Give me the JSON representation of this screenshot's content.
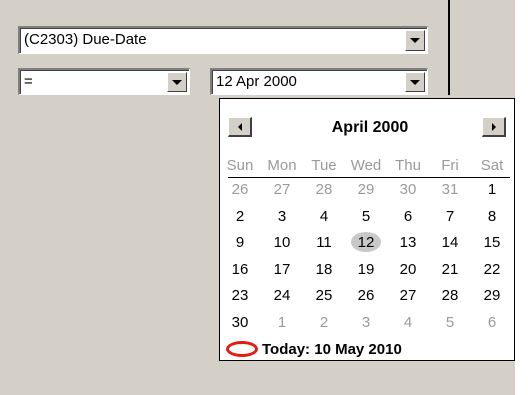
{
  "field_combo": {
    "value": "(C2303)  Due-Date"
  },
  "operator_combo": {
    "value": "="
  },
  "date_combo": {
    "value": "12 Apr 2000"
  },
  "calendar": {
    "title": "April 2000",
    "weekdays": [
      "Sun",
      "Mon",
      "Tue",
      "Wed",
      "Thu",
      "Fri",
      "Sat"
    ],
    "weeks": [
      [
        {
          "d": "26",
          "o": true
        },
        {
          "d": "27",
          "o": true
        },
        {
          "d": "28",
          "o": true
        },
        {
          "d": "29",
          "o": true
        },
        {
          "d": "30",
          "o": true
        },
        {
          "d": "31",
          "o": true
        },
        {
          "d": "1"
        }
      ],
      [
        {
          "d": "2"
        },
        {
          "d": "3"
        },
        {
          "d": "4"
        },
        {
          "d": "5"
        },
        {
          "d": "6"
        },
        {
          "d": "7"
        },
        {
          "d": "8"
        }
      ],
      [
        {
          "d": "9"
        },
        {
          "d": "10"
        },
        {
          "d": "11"
        },
        {
          "d": "12",
          "sel": true
        },
        {
          "d": "13"
        },
        {
          "d": "14"
        },
        {
          "d": "15"
        }
      ],
      [
        {
          "d": "16"
        },
        {
          "d": "17"
        },
        {
          "d": "18"
        },
        {
          "d": "19"
        },
        {
          "d": "20"
        },
        {
          "d": "21"
        },
        {
          "d": "22"
        }
      ],
      [
        {
          "d": "23"
        },
        {
          "d": "24"
        },
        {
          "d": "25"
        },
        {
          "d": "26"
        },
        {
          "d": "27"
        },
        {
          "d": "28"
        },
        {
          "d": "29"
        }
      ],
      [
        {
          "d": "30"
        },
        {
          "d": "1",
          "o": true
        },
        {
          "d": "2",
          "o": true
        },
        {
          "d": "3",
          "o": true
        },
        {
          "d": "4",
          "o": true
        },
        {
          "d": "5",
          "o": true
        },
        {
          "d": "6",
          "o": true
        }
      ]
    ],
    "today_label": "Today: 10 May 2010",
    "today_icon": "red-circle-icon"
  },
  "colors": {
    "panel_bg": "#d4d0c8",
    "today_ring": "#e41b12",
    "other_month_text": "#9a9a9a",
    "selected_day_bg": "#c8c8c8"
  }
}
